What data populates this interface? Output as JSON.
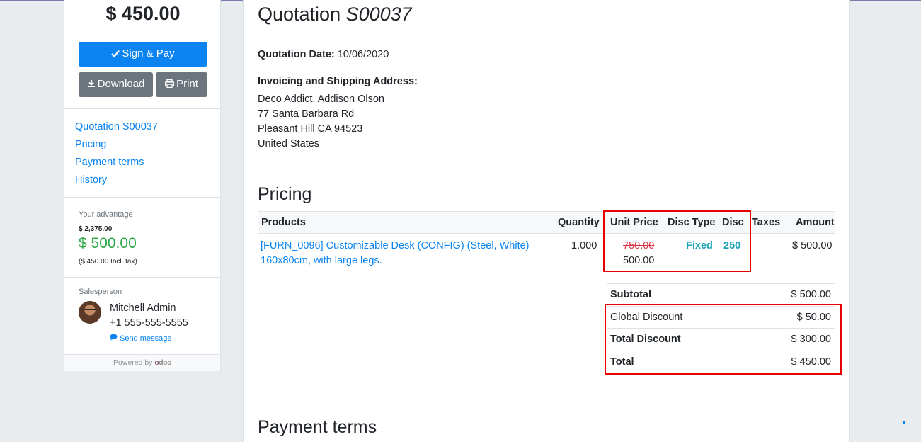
{
  "sidebar": {
    "total": "$ 450.00",
    "sign_pay_label": "Sign & Pay",
    "download_label": "Download",
    "print_label": "Print",
    "nav": [
      "Quotation S00037",
      "Pricing",
      "Payment terms",
      "History"
    ],
    "advantage": {
      "title": "Your advantage",
      "old_price": "$ 2,375.00",
      "new_price": "$ 500.00",
      "incl_tax": "($ 450.00 Incl. tax)"
    },
    "salesperson": {
      "title": "Salesperson",
      "name": "Mitchell Admin",
      "phone": "+1 555-555-5555",
      "send_message": "Send message"
    },
    "footer": {
      "powered_by": "Powered by",
      "logo_o": "o",
      "logo_rest": "doo"
    }
  },
  "main": {
    "title_prefix": "Quotation",
    "title_number": "S00037",
    "date_label": "Quotation Date:",
    "date_value": "10/06/2020",
    "address_label": "Invoicing and Shipping Address:",
    "address_lines": [
      "Deco Addict, Addison Olson",
      "77 Santa Barbara Rd",
      "Pleasant Hill CA 94523",
      "United States"
    ],
    "pricing_heading": "Pricing",
    "payment_terms_heading": "Payment terms",
    "table": {
      "headers": {
        "products": "Products",
        "quantity": "Quantity",
        "unit_price": "Unit Price",
        "disc_type": "Disc Type",
        "disc": "Disc",
        "taxes": "Taxes",
        "amount": "Amount"
      },
      "rows": [
        {
          "product_line1": "[FURN_0096] Customizable Desk (CONFIG) (Steel, White)",
          "product_line2": "160x80cm, with large legs.",
          "quantity": "1.000",
          "unit_price_old": "750.00",
          "unit_price": "500.00",
          "disc_type": "Fixed",
          "disc": "250",
          "taxes": "",
          "amount": "$ 500.00"
        }
      ]
    },
    "totals": {
      "subtotal_label": "Subtotal",
      "subtotal_value": "$ 500.00",
      "global_discount_label": "Global Discount",
      "global_discount_value": "$ 50.00",
      "total_discount_label": "Total Discount",
      "total_discount_value": "$ 300.00",
      "total_label": "Total",
      "total_value": "$ 450.00"
    }
  },
  "colors": {
    "primary": "#0b84f1",
    "secondary": "#6c757d",
    "success": "#28a745",
    "highlight": "#e60000",
    "teal": "#17a2b8",
    "danger": "#dc3545"
  }
}
